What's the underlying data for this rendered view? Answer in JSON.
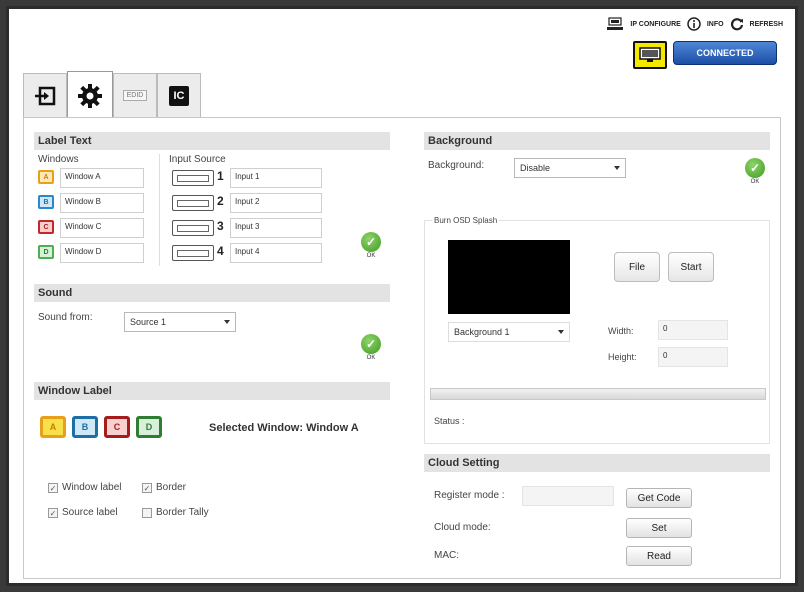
{
  "topbar": {
    "ip_configure": "IP CONFIGURE",
    "info": "INFO",
    "refresh": "REFRESH",
    "connection_status": "CONNECTED"
  },
  "tabs": [
    {
      "icon": "input-icon",
      "label": ""
    },
    {
      "icon": "gear-icon",
      "label": ""
    },
    {
      "icon": "edid-icon",
      "label": "EDID"
    },
    {
      "icon": "ic-icon",
      "label": "IC"
    }
  ],
  "label_text": {
    "title": "Label Text",
    "windows_header": "Windows",
    "input_source_header": "Input Source",
    "windows": [
      {
        "letter": "A",
        "value": "Window A"
      },
      {
        "letter": "B",
        "value": "Window B"
      },
      {
        "letter": "C",
        "value": "Window C"
      },
      {
        "letter": "D",
        "value": "Window D"
      }
    ],
    "inputs": [
      {
        "number": "1",
        "value": "Input 1"
      },
      {
        "number": "2",
        "value": "Input 2"
      },
      {
        "number": "3",
        "value": "Input 3"
      },
      {
        "number": "4",
        "value": "Input 4"
      }
    ],
    "ok_label": "OK"
  },
  "sound": {
    "title": "Sound",
    "sound_from_label": "Sound from:",
    "sound_from_value": "Source 1",
    "ok_label": "OK"
  },
  "window_label": {
    "title": "Window Label",
    "buttons": [
      "A",
      "B",
      "C",
      "D"
    ],
    "selected_text": "Selected Window: Window A",
    "checkboxes": [
      {
        "label": "Window label",
        "checked": true
      },
      {
        "label": "Border",
        "checked": true
      },
      {
        "label": "Source label",
        "checked": true
      },
      {
        "label": "Border Tally",
        "checked": false
      }
    ]
  },
  "background": {
    "title": "Background",
    "background_label": "Background:",
    "background_value": "Disable",
    "ok_label": "OK",
    "burn_osd_label": "Burn OSD Splash",
    "file_button": "File",
    "start_button": "Start",
    "splash_select_value": "Background 1",
    "width_label": "Width:",
    "width_value": "0",
    "height_label": "Height:",
    "height_value": "0",
    "status_label": "Status :"
  },
  "cloud": {
    "title": "Cloud Setting",
    "register_mode_label": "Register mode :",
    "register_mode_value": "",
    "get_code_button": "Get Code",
    "cloud_mode_label": "Cloud mode:",
    "set_button": "Set",
    "mac_label": "MAC:",
    "read_button": "Read"
  },
  "colors": {
    "accent": "#1b4fa6",
    "connect_highlight": "#f2e800",
    "ok_green": "#3d9b1f",
    "window_a": "#e8a01a",
    "window_b": "#2a8ac9",
    "window_c": "#c62828",
    "window_d": "#4caf50"
  }
}
